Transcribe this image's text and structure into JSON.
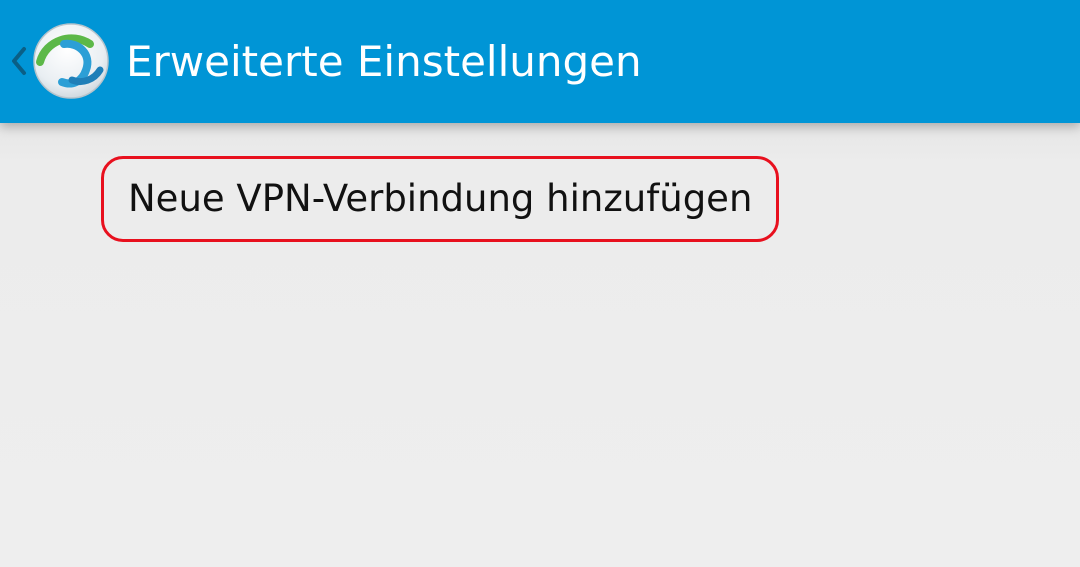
{
  "app_bar": {
    "title": "Erweiterte Einstellungen",
    "back_icon": "chevron-left-icon",
    "logo_icon": "vpn-client-logo-icon",
    "background_color": "#0095d6",
    "title_color": "#ffffff"
  },
  "content": {
    "items": [
      {
        "label": "Neue VPN-Verbindung hinzufügen",
        "highlight_color": "#e8101e"
      }
    ],
    "background_color": "#eeeeee"
  }
}
